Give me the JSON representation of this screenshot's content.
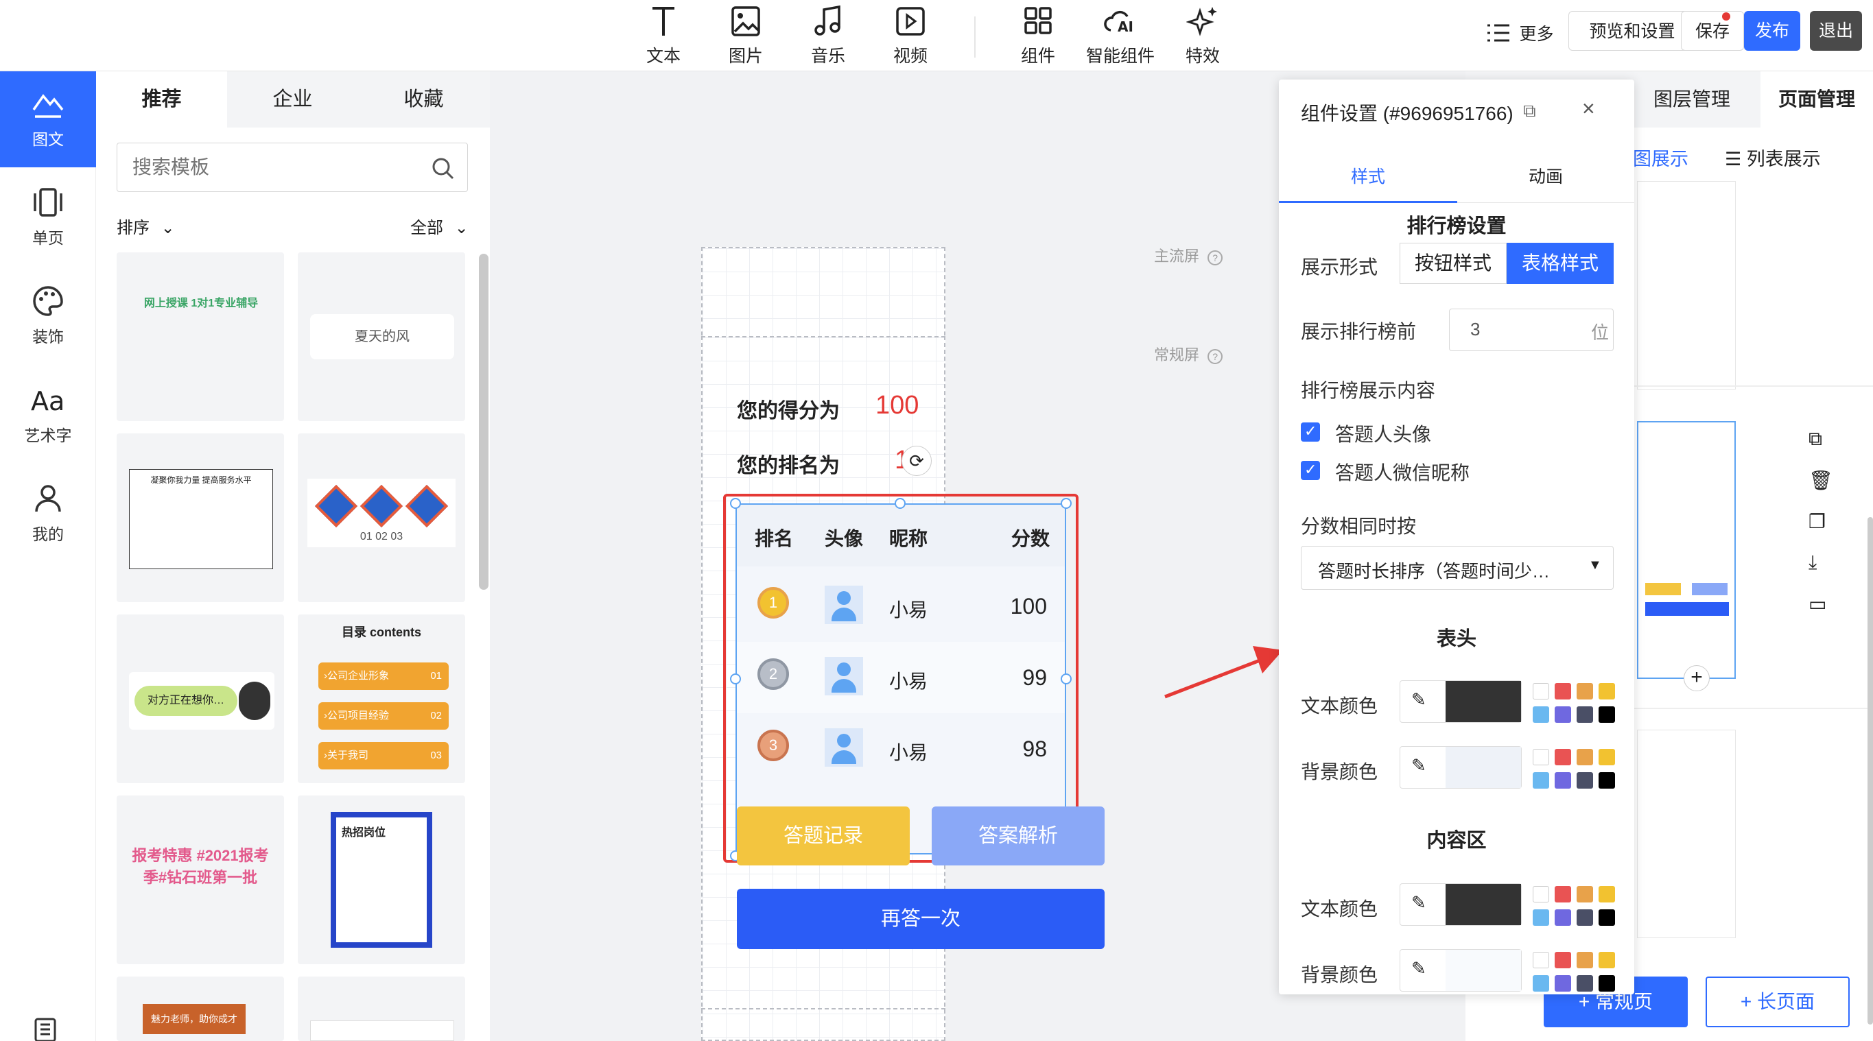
{
  "toolbar": {
    "tools": [
      {
        "label": "文本"
      },
      {
        "label": "图片"
      },
      {
        "label": "音乐"
      },
      {
        "label": "视频"
      },
      {
        "label": "组件"
      },
      {
        "label": "智能组件"
      },
      {
        "label": "特效"
      }
    ],
    "more_label": "更多",
    "preview_label": "预览和设置",
    "save_label": "保存",
    "publish_label": "发布",
    "exit_label": "退出",
    "accent": "#2f6bff"
  },
  "rail": {
    "items": [
      {
        "label": "图文",
        "icon": "mountain-text-icon"
      },
      {
        "label": "单页",
        "icon": "page-icon"
      },
      {
        "label": "装饰",
        "icon": "palette-icon"
      },
      {
        "label": "艺术字",
        "icon": "art-text-icon"
      },
      {
        "label": "我的",
        "icon": "user-icon"
      }
    ]
  },
  "templates": {
    "tabs": [
      "推荐",
      "企业",
      "收藏"
    ],
    "search_placeholder": "搜索模板",
    "sort_label": "排序",
    "filter_label": "全部",
    "cards": [
      {
        "text": "网上授课 1对1专业辅导"
      },
      {
        "text": "夏天的风"
      },
      {
        "text": "凝聚你我力量 提高服务水平"
      },
      {
        "text": "01 02 03"
      },
      {
        "text": "对方正在想你…"
      },
      {
        "text": "目录 contents"
      },
      {
        "text": "报考特惠 #2021报考季#钻石班第一批"
      },
      {
        "text": "热招岗位"
      },
      {
        "text": "魅力老师，助你成才"
      },
      {
        "text": ""
      }
    ],
    "contents_items": [
      "›公司企业形象",
      "›公司项目经验",
      "›关于我司"
    ],
    "contents_nums": [
      "01",
      "02",
      "03"
    ]
  },
  "canvas": {
    "main_screen_label": "主流屏",
    "normal_screen_label": "常规屏",
    "score_label": "您的得分为",
    "score_value": "100",
    "rank_label": "您的排名为",
    "rank_value": "1",
    "table": {
      "headers": [
        "排名",
        "头像",
        "昵称",
        "分数"
      ],
      "rows": [
        {
          "rank": "1",
          "name": "小易",
          "score": "100"
        },
        {
          "rank": "2",
          "name": "小易",
          "score": "99"
        },
        {
          "rank": "3",
          "name": "小易",
          "score": "98"
        }
      ]
    },
    "btn_records": "答题记录",
    "btn_analysis": "答案解析",
    "btn_retry": "再答一次"
  },
  "settings": {
    "title": "组件设置 (#9696951766)",
    "tabs": [
      "样式",
      "动画"
    ],
    "section_title": "排行榜设置",
    "display_form_label": "展示形式",
    "display_opts": [
      "按钮样式",
      "表格样式"
    ],
    "top_n_label": "展示排行榜前",
    "top_n_value": "3",
    "top_n_unit": "位",
    "content_label": "排行榜展示内容",
    "check_avatar": "答题人头像",
    "check_nickname": "答题人微信昵称",
    "tie_label": "分数相同时按",
    "tie_value": "答题时长排序（答题时间少…",
    "header_section": "表头",
    "content_section": "内容区",
    "text_color_label": "文本颜色",
    "bg_color_label": "背景颜色",
    "palette": [
      "#ffffff",
      "#e95353",
      "#e8a24a",
      "#f2c230",
      "#6ab8f0",
      "#6f68e0",
      "#4a4f66",
      "#000000"
    ]
  },
  "rightpanel": {
    "tabs": [
      "图层管理",
      "页面管理"
    ],
    "view_grid": "图展示",
    "view_list": "列表展示",
    "btn_normal_page": "+ 常规页",
    "btn_long_page": "+ 长页面"
  }
}
